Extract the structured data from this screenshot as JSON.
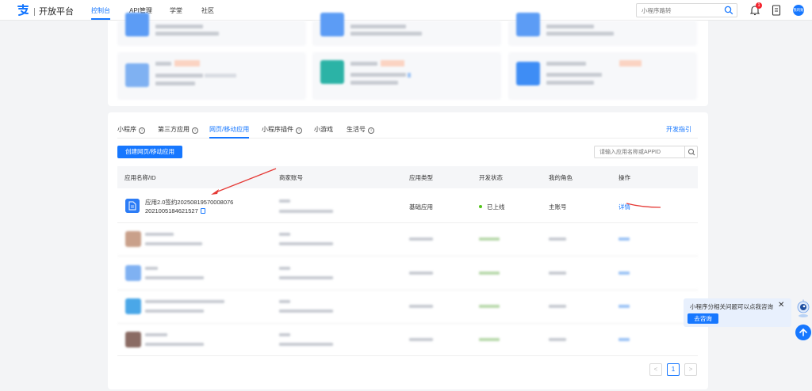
{
  "brand": {
    "name": "开放平台"
  },
  "nav": [
    {
      "label": "控制台",
      "active": true
    },
    {
      "label": "API管理",
      "active": false
    },
    {
      "label": "学堂",
      "active": false
    },
    {
      "label": "社区",
      "active": false
    }
  ],
  "top_search": {
    "placeholder": "小程序路转"
  },
  "notifications": {
    "count": "1"
  },
  "avatar": {
    "text": "我的账"
  },
  "tabs": [
    {
      "label": "小程序",
      "info": true,
      "active": false
    },
    {
      "label": "第三方应用",
      "info": true,
      "active": false
    },
    {
      "label": "网页/移动应用",
      "info": false,
      "active": true
    },
    {
      "label": "小程序插件",
      "info": true,
      "active": false
    },
    {
      "label": "小游戏",
      "info": false,
      "active": false
    },
    {
      "label": "生活号",
      "info": true,
      "active": false
    }
  ],
  "dev_guide": "开发指引",
  "create_button": "创建网页/移动应用",
  "table_search": {
    "placeholder": "请输入应用名称或APPID"
  },
  "table": {
    "headers": [
      "应用名称/ID",
      "商家账号",
      "应用类型",
      "开发状态",
      "我的角色",
      "操作"
    ],
    "first_row": {
      "name": "应用2.0签约20250819570008076",
      "id": "2021005184621527",
      "type": "基础应用",
      "status": "已上线",
      "role": "主账号",
      "action": "详情"
    }
  },
  "pagination": {
    "current": "1",
    "prev": "<",
    "next": ">"
  },
  "help": {
    "text": "小程序分相关问题可以点我咨询",
    "button": "去咨询",
    "close": "✕"
  },
  "colors": {
    "accent": "#1677ff",
    "online": "#52c41a",
    "annotation": "#e53935"
  }
}
